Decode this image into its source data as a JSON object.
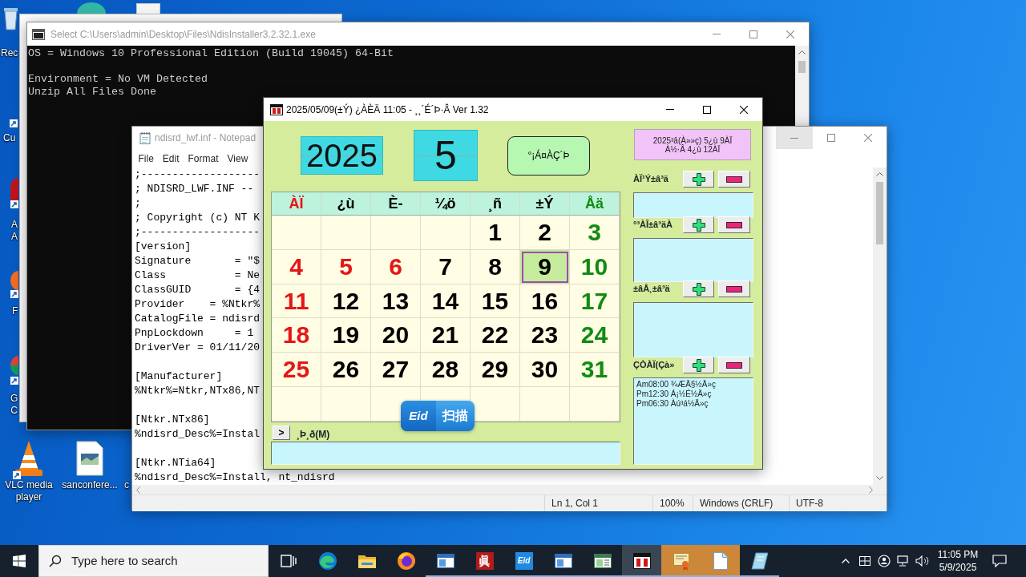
{
  "desktop": {
    "icons": [
      {
        "kind": "bin",
        "lines": [
          "Rec"
        ]
      },
      {
        "kind": "shortcut",
        "lines": [
          "Cu"
        ]
      },
      {
        "kind": "tile",
        "lines": [
          "A",
          "A"
        ]
      },
      {
        "kind": "flame",
        "lines": [
          "F"
        ]
      },
      {
        "kind": "wheel",
        "lines": [
          "G",
          "C"
        ]
      },
      {
        "kind": "cone",
        "lines": [
          "VLC media",
          "player"
        ]
      },
      {
        "kind": "picture",
        "lines": [
          "sanconfere..."
        ]
      },
      {
        "kind": "hidden",
        "lines": [
          "c"
        ]
      }
    ]
  },
  "console": {
    "title": "Select C:\\Users\\admin\\Desktop\\Files\\NdisInstaller3.2.32.1.exe",
    "active": false,
    "controls": [
      {
        "kind": "minimize",
        "hovered": false
      },
      {
        "kind": "maximize",
        "hovered": false
      },
      {
        "kind": "close",
        "hovered": false
      }
    ],
    "paragraphs": [
      [
        "OS = Windows 10 Professional Edition (Build 19045) 64-Bit"
      ],
      [
        "Environment = No VM Detected",
        "Unzip All Files Done"
      ]
    ]
  },
  "notepad": {
    "title": "ndisrd_lwf.inf - Notepad",
    "active": false,
    "controls": [
      {
        "kind": "minimize",
        "hovered": true
      },
      {
        "kind": "maximize",
        "hovered": false
      },
      {
        "kind": "close",
        "hovered": false
      }
    ],
    "menu": [
      "File",
      "Edit",
      "Format",
      "View"
    ],
    "paragraphs": [
      [
        ";-------------------",
        "; NDISRD_LWF.INF --",
        ";",
        "; Copyright (c) NT K",
        ";-------------------",
        "[version]",
        "Signature       = \"$",
        "Class           = Ne",
        "ClassGUID       = {4",
        "Provider    = %Ntkr%",
        "CatalogFile = ndisrd",
        "PnpLockdown     = 1",
        "DriverVer = 01/11/20"
      ],
      [
        "[Manufacturer]",
        "%Ntkr%=Ntkr,NTx86,NT"
      ],
      [
        "[Ntkr.NTx86]",
        "%ndisrd_Desc%=Instal"
      ],
      [
        "[Ntkr.NTia64]",
        "%ndisrd_Desc%=Install, nt_ndisrd"
      ]
    ],
    "status": [
      "Ln 1, Col 1",
      "100%",
      "Windows (CRLF)",
      "UTF-8"
    ]
  },
  "calendar": {
    "title": "2025/05/09(±Ý) ¿ÀÈÄ 11:05 - ¸¸´É´Þ·Â Ver 1.32",
    "active": true,
    "controls": [
      {
        "kind": "minimize",
        "hovered": false
      },
      {
        "kind": "maximize",
        "hovered": false
      },
      {
        "kind": "close",
        "hovered": false
      }
    ],
    "year": "2025",
    "month": "5",
    "theme_button": "°¡Á¤ÀÇ´Þ",
    "date_info": [
      "2025³â(À»»ç) 5¿ù 9ÀÏ",
      "À½·Â 4¿ù 12ÀÏ"
    ],
    "weekdays": [
      {
        "label": "ÀÏ",
        "color": "#e51616"
      },
      {
        "label": "¿ù",
        "color": "#000000"
      },
      {
        "label": "È-",
        "color": "#000000"
      },
      {
        "label": "¼ö",
        "color": "#000000"
      },
      {
        "label": "¸ñ",
        "color": "#000000"
      },
      {
        "label": "±Ý",
        "color": "#000000"
      },
      {
        "label": "Åä",
        "color": "#138a13"
      }
    ],
    "weeks": [
      [
        {
          "day": "1",
          "color": "#000000",
          "selected": false
        },
        {
          "day": "2",
          "color": "#000000",
          "selected": false
        },
        {
          "day": "3",
          "color": "#138a13",
          "selected": false
        }
      ],
      [
        {
          "day": "4",
          "color": "#e51616",
          "selected": false
        },
        {
          "day": "5",
          "color": "#e51616",
          "selected": false
        },
        {
          "day": "6",
          "color": "#e51616",
          "selected": false
        },
        {
          "day": "7",
          "color": "#000000",
          "selected": false
        },
        {
          "day": "8",
          "color": "#000000",
          "selected": false
        },
        {
          "day": "9",
          "color": "#000000",
          "selected": true
        },
        {
          "day": "10",
          "color": "#138a13",
          "selected": false
        }
      ],
      [
        {
          "day": "11",
          "color": "#e51616",
          "selected": false
        },
        {
          "day": "12",
          "color": "#000000",
          "selected": false
        },
        {
          "day": "13",
          "color": "#000000",
          "selected": false
        },
        {
          "day": "14",
          "color": "#000000",
          "selected": false
        },
        {
          "day": "15",
          "color": "#000000",
          "selected": false
        },
        {
          "day": "16",
          "color": "#000000",
          "selected": false
        },
        {
          "day": "17",
          "color": "#138a13",
          "selected": false
        }
      ],
      [
        {
          "day": "18",
          "color": "#e51616",
          "selected": false
        },
        {
          "day": "19",
          "color": "#000000",
          "selected": false
        },
        {
          "day": "20",
          "color": "#000000",
          "selected": false
        },
        {
          "day": "21",
          "color": "#000000",
          "selected": false
        },
        {
          "day": "22",
          "color": "#000000",
          "selected": false
        },
        {
          "day": "23",
          "color": "#000000",
          "selected": false
        },
        {
          "day": "24",
          "color": "#138a13",
          "selected": false
        }
      ],
      [
        {
          "day": "25",
          "color": "#e51616",
          "selected": false
        },
        {
          "day": "26",
          "color": "#000000",
          "selected": false
        },
        {
          "day": "27",
          "color": "#000000",
          "selected": false
        },
        {
          "day": "28",
          "color": "#000000",
          "selected": false
        },
        {
          "day": "29",
          "color": "#000000",
          "selected": false
        },
        {
          "day": "30",
          "color": "#000000",
          "selected": false
        },
        {
          "day": "31",
          "color": "#138a13",
          "selected": false
        }
      ]
    ],
    "memo": {
      "toggle": ">",
      "label": "¸Þ¸ð(M)"
    },
    "sections": [
      {
        "label": "ÀÏ¹Ý±â³ä"
      },
      {
        "label": "°³ÀÎ±â³äÀ"
      },
      {
        "label": "±âÅ¸±â³ä"
      },
      {
        "label": "ÇÒÀÏ(Çà»",
        "entries": [
          "Am08:00 ¾ÆÄ§½Ä»ç",
          "Pm12:30 Á¡½É½Ä»ç",
          "Pm06:30 Àú³á½Ä»ç"
        ]
      }
    ]
  },
  "scan_widget": {
    "logo": "Eid",
    "label": "扫描"
  },
  "taskbar": {
    "search": {
      "placeholder": "Type here to search"
    },
    "apps": [
      {
        "kind": "taskview",
        "running": false,
        "active": false,
        "flashing": false
      },
      {
        "kind": "edge",
        "running": false,
        "active": false,
        "flashing": false
      },
      {
        "kind": "folder",
        "running": false,
        "active": false,
        "flashing": false
      },
      {
        "kind": "firefox",
        "running": false,
        "active": false,
        "flashing": false
      },
      {
        "kind": "window",
        "running": true,
        "active": false,
        "flashing": false
      },
      {
        "kind": "seal",
        "glyph": "眞",
        "running": true,
        "active": false,
        "flashing": false
      },
      {
        "kind": "badge",
        "glyph": "Eid",
        "running": true,
        "active": false,
        "flashing": false
      },
      {
        "kind": "window",
        "running": true,
        "active": false,
        "flashing": false
      },
      {
        "kind": "panel",
        "running": true,
        "active": false,
        "flashing": false
      },
      {
        "kind": "calendar",
        "running": true,
        "active": true,
        "flashing": false
      },
      {
        "kind": "certificate",
        "running": true,
        "active": false,
        "flashing": true
      },
      {
        "kind": "notepad",
        "running": true,
        "active": false,
        "flashing": true
      },
      {
        "kind": "notebook",
        "running": true,
        "active": false,
        "flashing": false
      }
    ],
    "clock": {
      "time": "11:05 PM",
      "date": "5/9/2025"
    }
  }
}
